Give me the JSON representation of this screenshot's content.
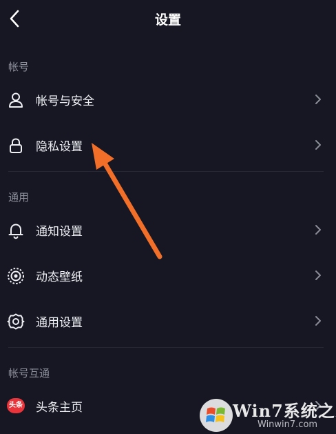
{
  "header": {
    "title": "设置",
    "back_icon": "chevron-left-icon"
  },
  "sections": [
    {
      "title": "帐号",
      "items": [
        {
          "label": "帐号与安全",
          "icon": "user-icon"
        },
        {
          "label": "隐私设置",
          "icon": "lock-icon"
        }
      ]
    },
    {
      "title": "通用",
      "items": [
        {
          "label": "通知设置",
          "icon": "bell-icon"
        },
        {
          "label": "动态壁纸",
          "icon": "live-wallpaper-icon"
        },
        {
          "label": "通用设置",
          "icon": "gear-icon"
        }
      ]
    },
    {
      "title": "帐号互通",
      "items": [
        {
          "label": "头条主页",
          "icon": "toutiao-logo-icon",
          "badge_text": "头条"
        }
      ]
    }
  ],
  "annotation": {
    "type": "arrow",
    "color": "#f26f2a",
    "points_to": "隐私设置"
  },
  "watermark": {
    "brand": "Win7系统之家",
    "url": "Winwin7.com"
  },
  "colors": {
    "background": "#161722",
    "text": "#eef0f4",
    "section_title": "#8e909c",
    "chevron": "#8a8c96",
    "divider": "#262833"
  }
}
